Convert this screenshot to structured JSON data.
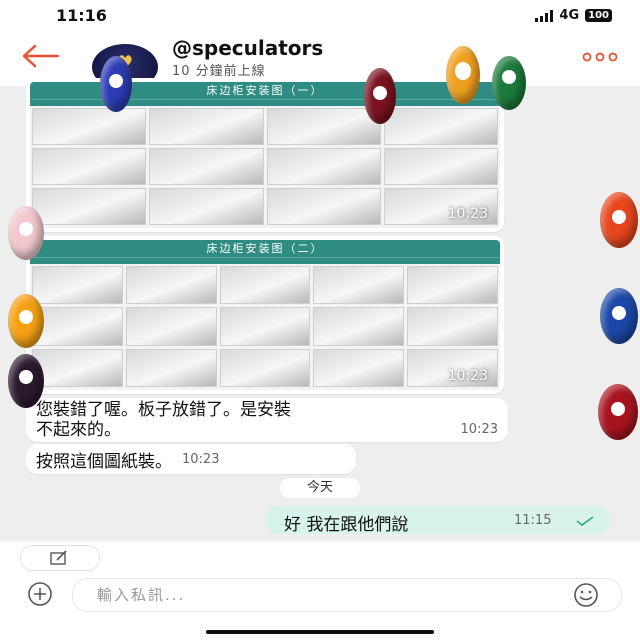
{
  "status_bar": {
    "time": "11:16",
    "network": "4G",
    "battery": "100"
  },
  "header": {
    "title": "@speculators",
    "subtitle": "10 分鐘前上線"
  },
  "messages": {
    "image1": {
      "heading": "床边柜安装图（一）",
      "time": "10:23"
    },
    "image2": {
      "heading": "床边柜安装图（二）",
      "time": "10:23"
    },
    "text1": {
      "line1": "您裝錯了喔。板子放錯了。是安裝",
      "line2": "不起來的。",
      "time": "10:23"
    },
    "text2": {
      "text": "按照這個圖紙裝。",
      "time": "10:23"
    },
    "day_separator": "今天",
    "sent": {
      "text": "好 我在跟他們說",
      "time": "11:15"
    }
  },
  "composer": {
    "placeholder": "輸入私訊..."
  },
  "colors": {
    "accent_red": "#e8502f",
    "sent_bubble": "#d8f2ec",
    "read_check": "#2aa57a",
    "instruction_header": "#2e8c82"
  },
  "icons": [
    "back-arrow-icon",
    "more-dots-icon",
    "note-edit-icon",
    "add-circle-icon",
    "emoji-icon",
    "read-check-icon"
  ]
}
